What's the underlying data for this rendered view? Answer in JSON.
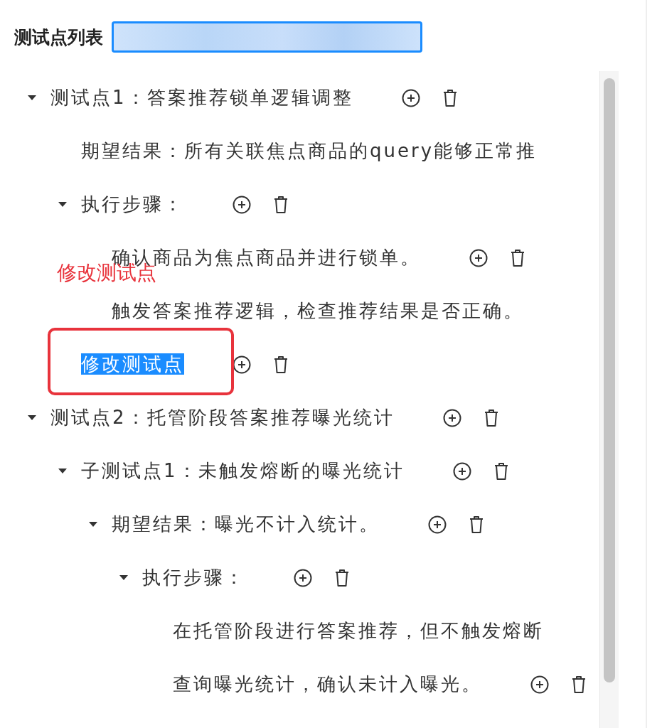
{
  "header": {
    "title": "测试点列表"
  },
  "annotation": {
    "text": "修改测试点"
  },
  "tree": [
    {
      "label": "测试点1：答案推荐锁单逻辑调整",
      "expanded": true,
      "actions": true,
      "selected": false,
      "children": [
        {
          "label": "期望结果：所有关联焦点商品的query能够正常推",
          "actions": false,
          "selected": false
        },
        {
          "label": "执行步骤：",
          "expanded": true,
          "actions": true,
          "selected": false,
          "children": [
            {
              "label": "确认商品为焦点商品并进行锁单。",
              "actions": true,
              "selected": false
            },
            {
              "label": "触发答案推荐逻辑，检查推荐结果是否正确。",
              "actions": false,
              "selected": false
            }
          ]
        },
        {
          "label": "修改测试点",
          "actions": true,
          "selected": true
        }
      ]
    },
    {
      "label": "测试点2：托管阶段答案推荐曝光统计",
      "expanded": true,
      "actions": true,
      "selected": false,
      "children": [
        {
          "label": "子测试点1：未触发熔断的曝光统计",
          "expanded": true,
          "actions": true,
          "selected": false,
          "children": [
            {
              "label": "期望结果：曝光不计入统计。",
              "expanded": true,
              "actions": true,
              "selected": false,
              "children": [
                {
                  "label": "执行步骤：",
                  "expanded": true,
                  "actions": true,
                  "selected": false,
                  "children": [
                    {
                      "label": "在托管阶段进行答案推荐，但不触发熔断",
                      "actions": false,
                      "selected": false
                    },
                    {
                      "label": "查询曝光统计，确认未计入曝光。",
                      "actions": true,
                      "selected": false
                    }
                  ]
                }
              ]
            }
          ]
        }
      ]
    }
  ]
}
